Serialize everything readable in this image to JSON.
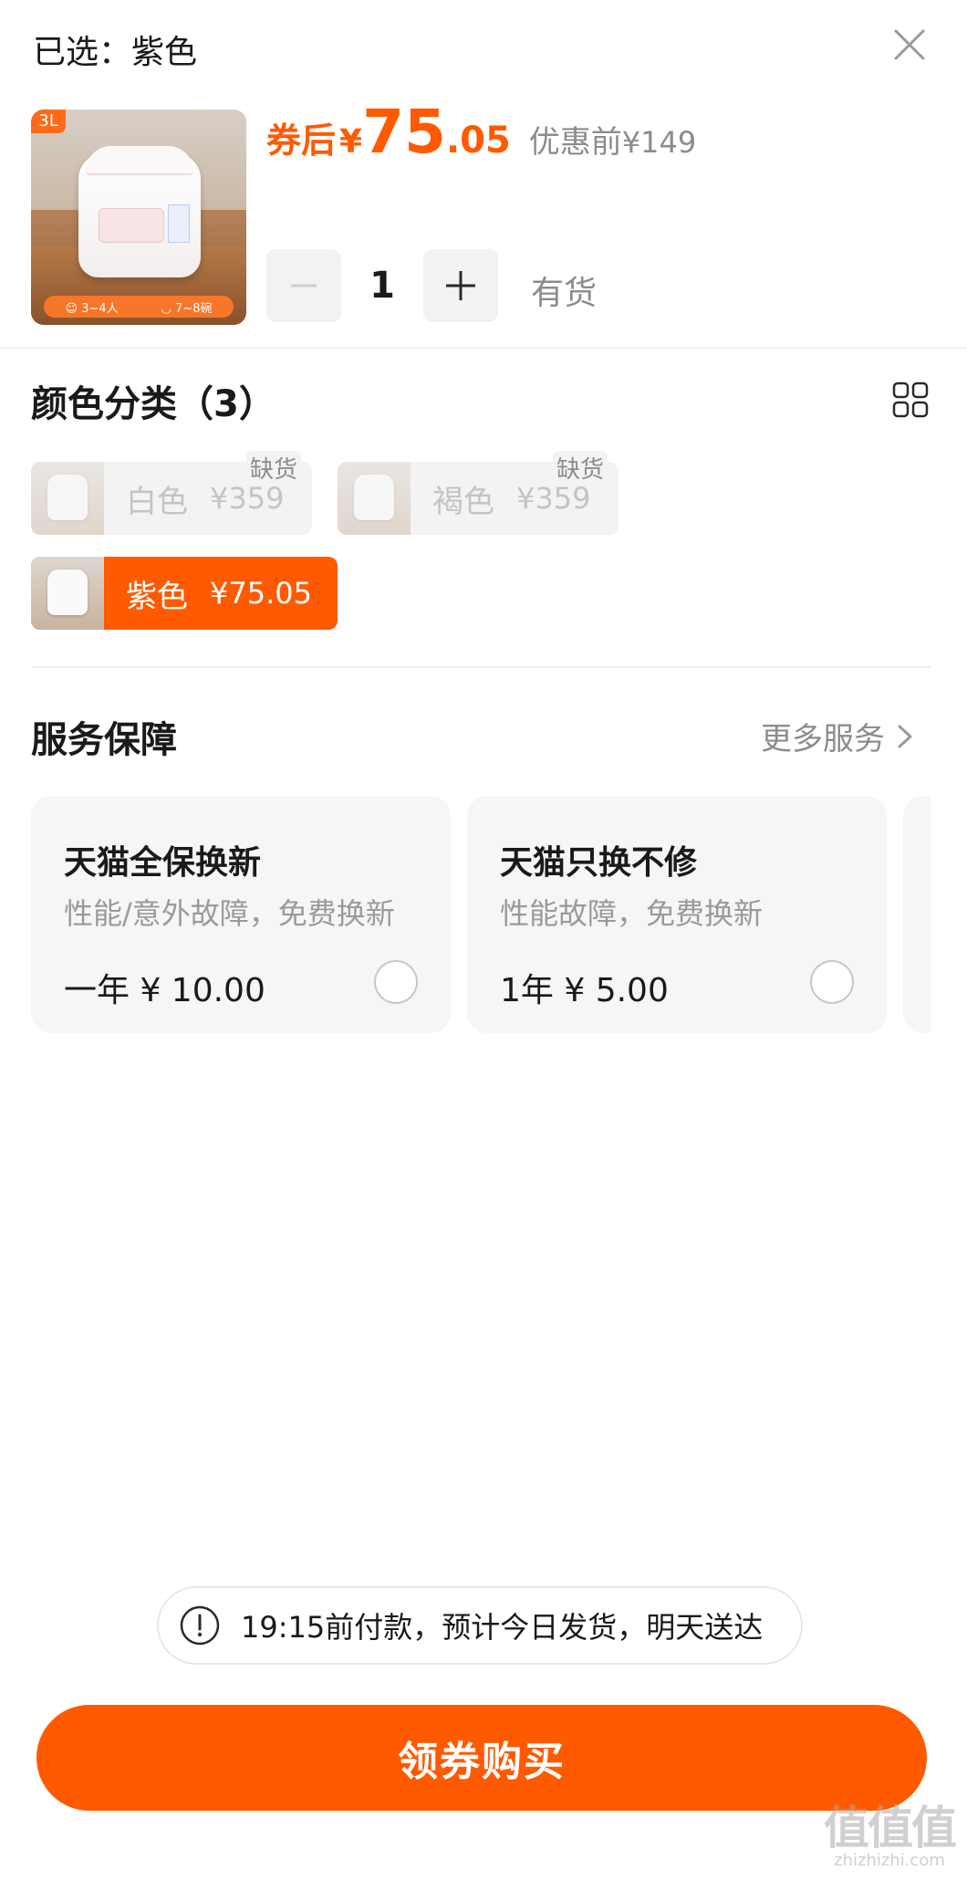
{
  "header": {
    "selected_text": "已选：紫色",
    "close_icon": "close-icon"
  },
  "product": {
    "capacity_tag": "3L",
    "thumb_people": "3~4人",
    "thumb_bowls": "7~8碗",
    "price_label": "券后",
    "price_currency": "¥",
    "price_integer": "75",
    "price_decimal": ".05",
    "original_label": "优惠前",
    "original_price": "¥149",
    "quantity": "1",
    "stock_status": "有货"
  },
  "color_section": {
    "title": "颜色分类（3）",
    "options": [
      {
        "name": "白色",
        "price": "¥359",
        "badge": "缺货",
        "state": "disabled"
      },
      {
        "name": "褐色",
        "price": "¥359",
        "badge": "缺货",
        "state": "disabled"
      },
      {
        "name": "紫色",
        "price": "¥75.05",
        "badge": "",
        "state": "selected"
      }
    ]
  },
  "service_section": {
    "title": "服务保障",
    "more_label": "更多服务",
    "cards": [
      {
        "title": "天猫全保换新",
        "desc": "性能/意外故障，免费换新",
        "price": "一年 ¥ 10.00"
      },
      {
        "title": "天猫只换不修",
        "desc": "性能故障，免费换新",
        "price": "1年 ¥ 5.00"
      }
    ]
  },
  "notice": {
    "text": "19:15前付款，预计今日发货，明天送达"
  },
  "buy_button": {
    "label": "领券购买"
  },
  "watermark": {
    "logo": "值值值",
    "url": "zhizhizhi.com"
  },
  "colors": {
    "accent": "#ff5a00",
    "muted_text": "#8c8c8c",
    "card_bg": "#f6f6f6"
  }
}
